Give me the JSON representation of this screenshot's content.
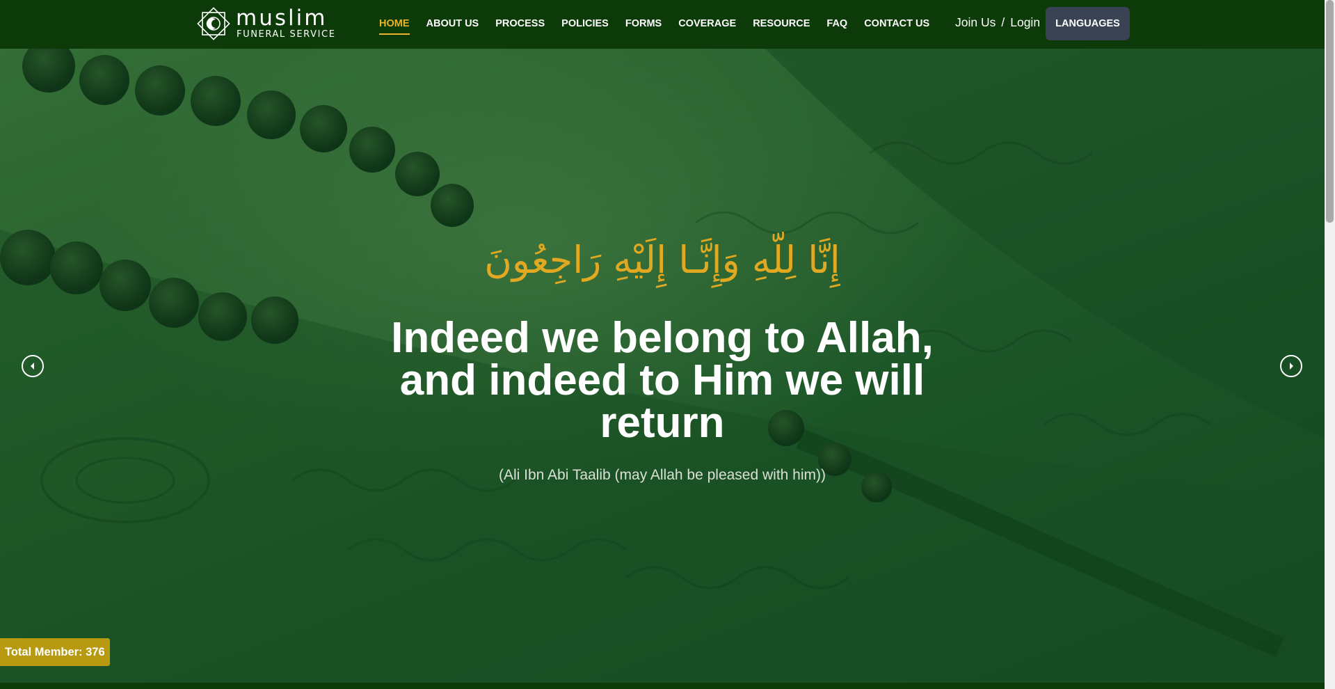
{
  "header": {
    "logo": {
      "word": "muslim",
      "sub": "FUNERAL SERVICE"
    },
    "nav": [
      {
        "label": "HOME",
        "active": true
      },
      {
        "label": "ABOUT US",
        "active": false
      },
      {
        "label": "PROCESS",
        "active": false
      },
      {
        "label": "POLICIES",
        "active": false
      },
      {
        "label": "FORMS",
        "active": false
      },
      {
        "label": "COVERAGE",
        "active": false
      },
      {
        "label": "RESOURCE",
        "active": false
      },
      {
        "label": "FAQ",
        "active": false
      },
      {
        "label": "CONTACT US",
        "active": false
      }
    ],
    "auth": {
      "join": "Join Us",
      "separator": "/",
      "login": "Login"
    },
    "languages_button": "LANGUAGES"
  },
  "hero": {
    "arabic": "إِنَّا لِلّهِ وَإِنَّـا إِلَيْهِ رَاجِعُونَ",
    "headline": "Indeed we belong to Allah, and indeed to Him we will return",
    "attribution": "(Ali Ibn Abi Taalib (may Allah be pleased with him))",
    "prev_icon": "chevron-left-icon",
    "next_icon": "chevron-right-icon"
  },
  "member_badge": "Total Member: 376",
  "colors": {
    "header_bg": "#0c3a08",
    "accent_gold": "#e9b42a",
    "arabic_gold": "#e1a821",
    "badge_bg": "#b89a10",
    "lang_button_bg": "#394353"
  }
}
